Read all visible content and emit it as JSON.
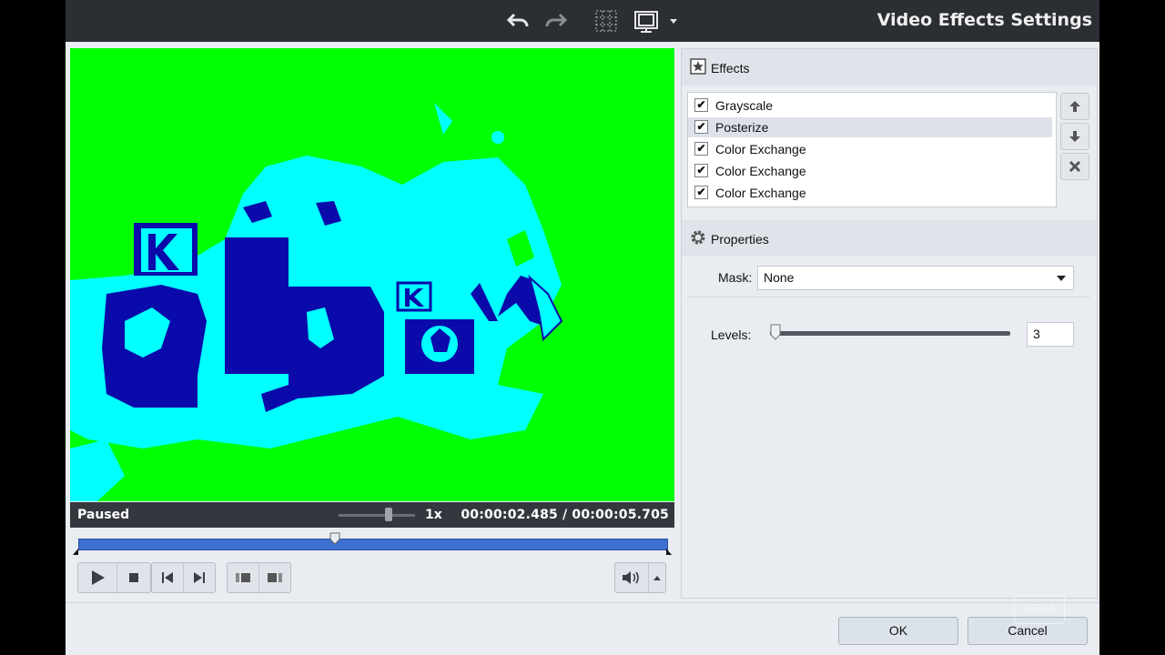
{
  "window": {
    "title": "Video Effects Settings"
  },
  "toolbar": {
    "undo": "undo-icon",
    "redo": "redo-icon",
    "grid": "grid-icon",
    "monitor": "monitor-icon",
    "dropdown": "chevron-down-icon"
  },
  "preview": {
    "status": "Paused",
    "speed": "1x",
    "time": "00:00:02.485  /  00:00:05.705",
    "playhead_fraction": 0.436,
    "colors": {
      "background": "#00ff00",
      "cyan": "#00ffff",
      "blue": "#0a0aaa"
    }
  },
  "transport": {
    "play": "play-icon",
    "stop": "stop-icon",
    "prev": "previous-frame-icon",
    "next": "next-frame-icon",
    "in": "mark-in-icon",
    "out": "mark-out-icon",
    "volume": "speaker-icon"
  },
  "effects": {
    "header": "Effects",
    "items": [
      {
        "label": "Grayscale",
        "checked": true,
        "selected": false
      },
      {
        "label": "Posterize",
        "checked": true,
        "selected": true
      },
      {
        "label": "Color Exchange",
        "checked": true,
        "selected": false
      },
      {
        "label": "Color Exchange",
        "checked": true,
        "selected": false
      },
      {
        "label": "Color Exchange",
        "checked": true,
        "selected": false
      }
    ],
    "check_glyph": "✔"
  },
  "properties": {
    "header": "Properties",
    "mask_label": "Mask:",
    "mask_value": "None",
    "levels_label": "Levels:",
    "levels_value": "3"
  },
  "footer": {
    "ok": "OK",
    "cancel": "Cancel"
  },
  "watermark": "VEGAS"
}
